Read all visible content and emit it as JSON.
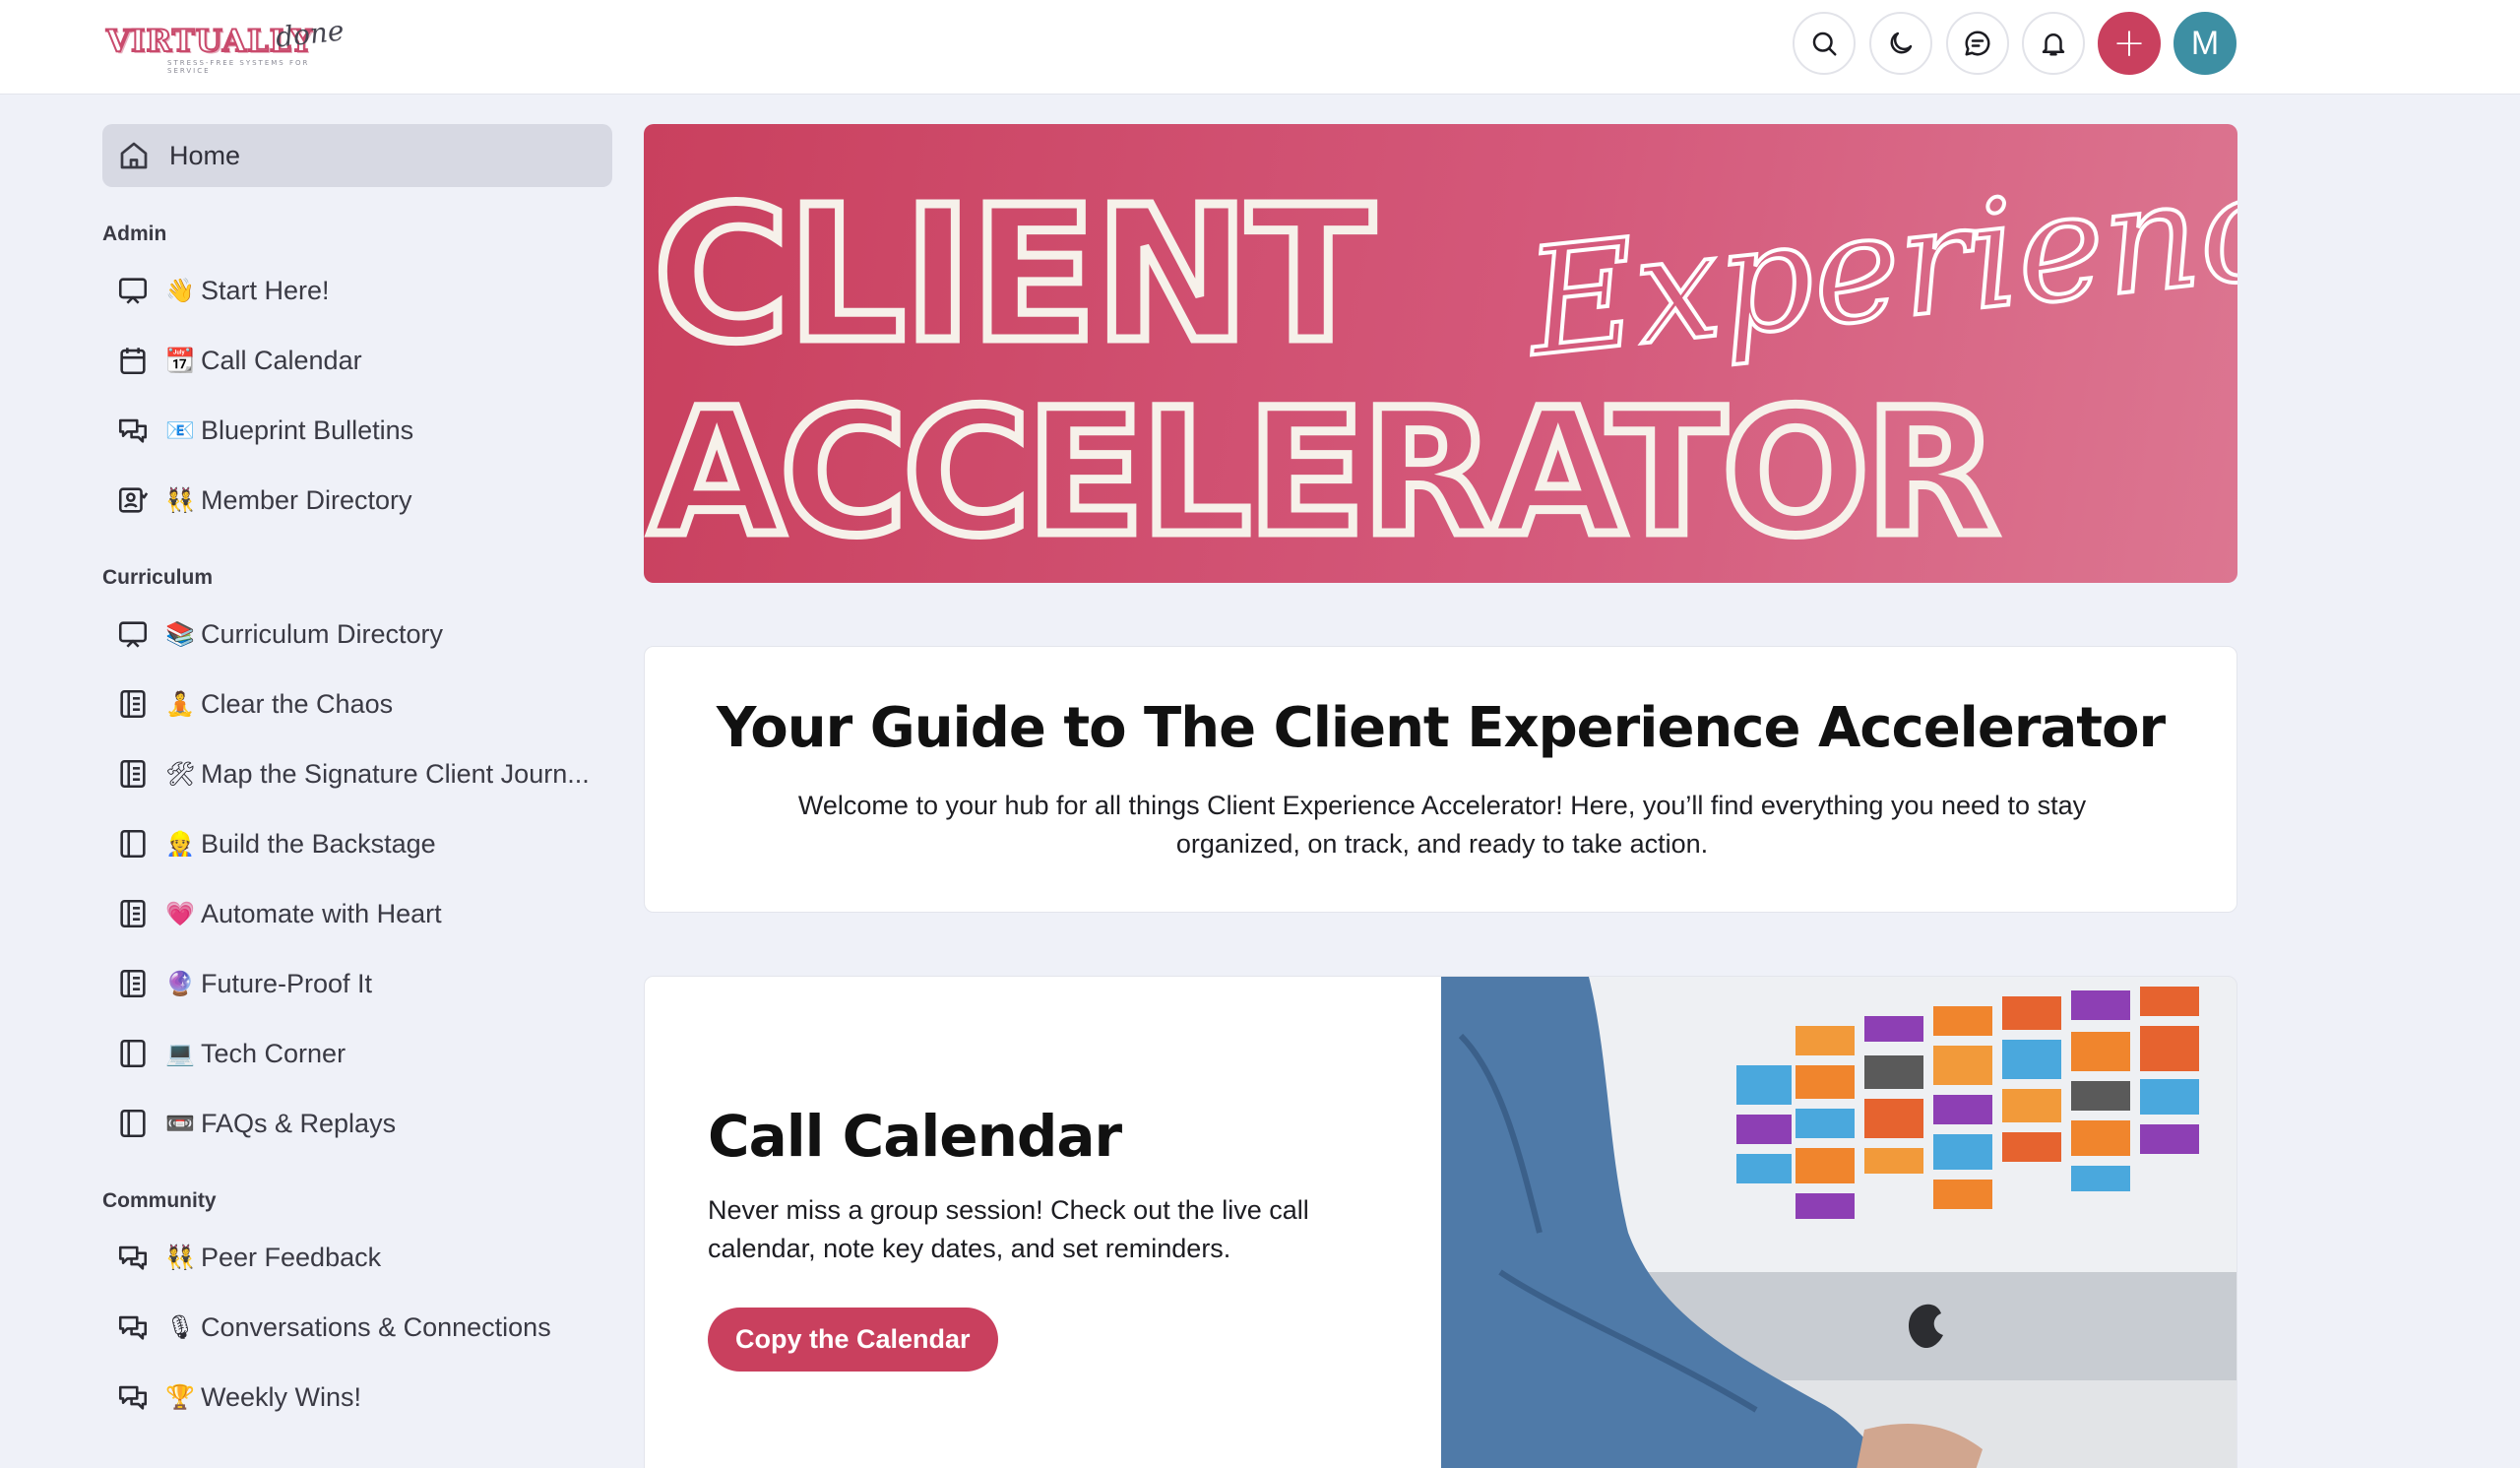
{
  "header": {
    "logo_text": "VIRTUALLY",
    "logo_script": "done",
    "logo_tagline": "STRESS-FREE SYSTEMS FOR SERVICE",
    "buttons": [
      "search-icon",
      "moon-icon",
      "chat-icon",
      "bell-icon",
      "plus-icon"
    ],
    "add_label": "+",
    "avatar_initial": "M",
    "colors": {
      "accent": "#c9405e",
      "avatar": "#3d8fa3"
    }
  },
  "sidebar": {
    "home": {
      "label": "Home",
      "icon": "home-icon"
    },
    "sections": [
      {
        "title": "Admin",
        "items": [
          {
            "label": "Start Here!",
            "emoji": "👋",
            "icon": "presentation-icon"
          },
          {
            "label": "Call Calendar",
            "emoji": "📆",
            "icon": "calendar-icon"
          },
          {
            "label": "Blueprint Bulletins",
            "emoji": "📧",
            "icon": "chat-bubbles-icon"
          },
          {
            "label": "Member Directory",
            "emoji": "👯",
            "icon": "member-directory-icon"
          }
        ]
      },
      {
        "title": "Curriculum",
        "items": [
          {
            "label": "Curriculum Directory",
            "emoji": "📚",
            "icon": "presentation-icon"
          },
          {
            "label": "Clear the Chaos",
            "emoji": "🧘",
            "icon": "document-list-icon"
          },
          {
            "label": "Map the Signature Client Journ...",
            "emoji": "🛠",
            "icon": "document-list-icon"
          },
          {
            "label": "Build the Backstage",
            "emoji": "👷",
            "icon": "panel-icon"
          },
          {
            "label": "Automate with Heart",
            "emoji": "💗",
            "icon": "document-list-icon"
          },
          {
            "label": "Future-Proof It",
            "emoji": "🔮",
            "icon": "document-list-icon"
          },
          {
            "label": "Tech Corner",
            "emoji": "💻",
            "icon": "panel-icon"
          },
          {
            "label": "FAQs & Replays",
            "emoji": "📼",
            "icon": "panel-icon"
          }
        ]
      },
      {
        "title": "Community",
        "items": [
          {
            "label": "Peer Feedback",
            "emoji": "👯",
            "icon": "chat-bubbles-icon"
          },
          {
            "label": "Conversations & Connections",
            "emoji": "🎙",
            "icon": "chat-bubbles-icon"
          },
          {
            "label": "Weekly Wins!",
            "emoji": "🏆",
            "icon": "chat-bubbles-icon"
          }
        ]
      }
    ]
  },
  "banner": {
    "line1": "CLIENT",
    "script": "Experience",
    "line2": "ACCELERATOR"
  },
  "guide": {
    "title": "Your Guide to The Client Experience Accelerator",
    "body": "Welcome to your hub for all things Client Experience Accelerator! Here, you’ll find everything you need to stay organized, on track, and ready to take action."
  },
  "call_calendar": {
    "title": "Call Calendar",
    "body": "Never miss a group session! Check out the live call calendar, note key dates, and set reminders.",
    "button": "Copy the Calendar"
  }
}
